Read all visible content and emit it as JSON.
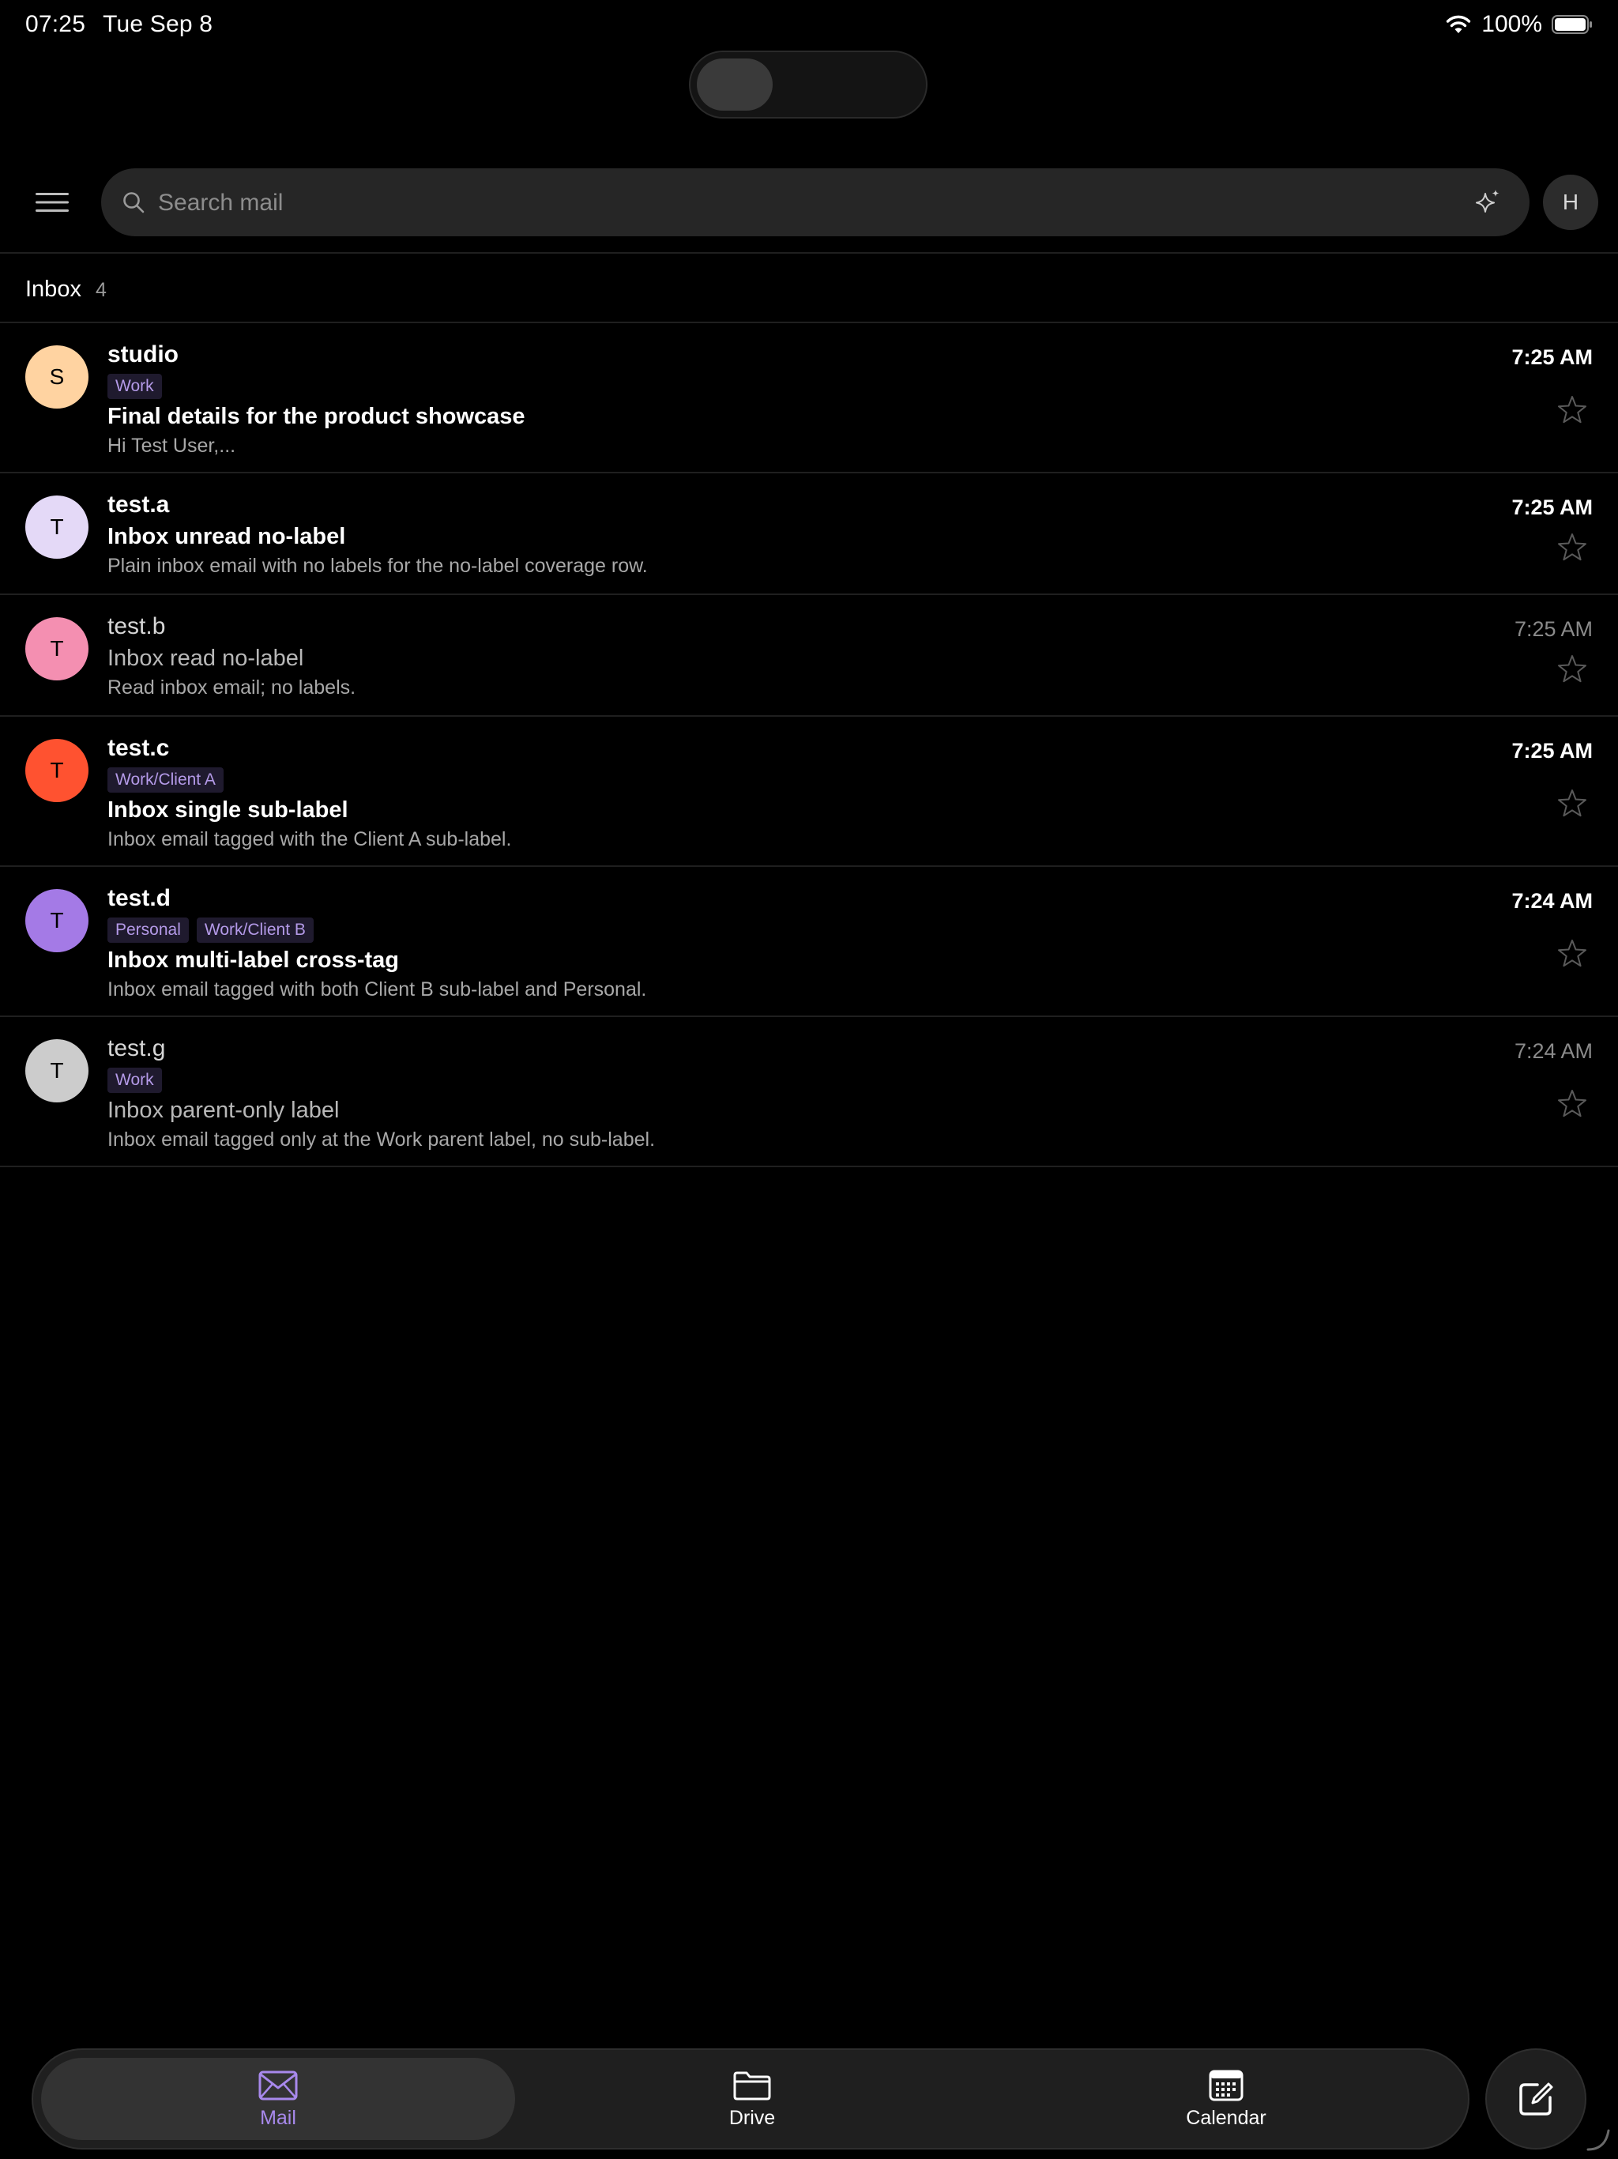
{
  "status_bar": {
    "time": "07:25",
    "date": "Tue Sep 8",
    "battery": "100%"
  },
  "search": {
    "placeholder": "Search mail"
  },
  "account": {
    "initial": "H"
  },
  "inbox": {
    "title": "Inbox",
    "count": "4"
  },
  "emails": [
    {
      "initial": "S",
      "avatar_color": "#FFD3A1",
      "sender": "studio",
      "labels": [
        "Work"
      ],
      "subject": "Final details for the product showcase",
      "snippet": "Hi Test User,...",
      "time": "7:25 AM",
      "unread": true
    },
    {
      "initial": "T",
      "avatar_color": "#E4D9F7",
      "sender": "test.a",
      "labels": [],
      "subject": "Inbox unread no-label",
      "snippet": "Plain inbox email with no labels for the no-label coverage row.",
      "time": "7:25 AM",
      "unread": true
    },
    {
      "initial": "T",
      "avatar_color": "#F48FB1",
      "sender": "test.b",
      "labels": [],
      "subject": "Inbox read no-label",
      "snippet": "Read inbox email; no labels.",
      "time": "7:25 AM",
      "unread": false
    },
    {
      "initial": "T",
      "avatar_color": "#FF5230",
      "sender": "test.c",
      "labels": [
        "Work/Client A"
      ],
      "subject": "Inbox single sub-label",
      "snippet": "Inbox email tagged with the Client A sub-label.",
      "time": "7:25 AM",
      "unread": true
    },
    {
      "initial": "T",
      "avatar_color": "#A47AE6",
      "sender": "test.d",
      "labels": [
        "Personal",
        "Work/Client B"
      ],
      "subject": "Inbox multi-label cross-tag",
      "snippet": "Inbox email tagged with both Client B sub-label and Personal.",
      "time": "7:24 AM",
      "unread": true
    },
    {
      "initial": "T",
      "avatar_color": "#CCCCCC",
      "sender": "test.g",
      "labels": [
        "Work"
      ],
      "subject": "Inbox parent-only label",
      "snippet": "Inbox email tagged only at the Work parent label, no sub-label.",
      "time": "7:24 AM",
      "unread": false
    }
  ],
  "tabs": [
    {
      "label": "Mail",
      "icon": "envelope-icon",
      "active": true
    },
    {
      "label": "Drive",
      "icon": "folder-icon",
      "active": false
    },
    {
      "label": "Calendar",
      "icon": "calendar-icon",
      "active": false
    }
  ],
  "colors": {
    "accent": "#A889EC",
    "label_text": "#B49AE8",
    "label_bg": "#1F1A2E",
    "background": "#000000"
  }
}
